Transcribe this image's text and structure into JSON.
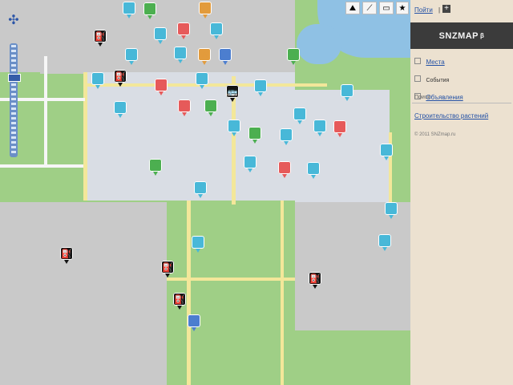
{
  "header": {
    "login": "Пойти",
    "login_sep": "|",
    "logo": "SNZMAP",
    "logo_sup": "β"
  },
  "sidebar": {
    "items": [
      {
        "label": "Места",
        "link": true
      },
      {
        "label": "События",
        "link": false
      },
      {
        "label": "Объявления",
        "link": true
      }
    ],
    "search_label": "Поиск",
    "extra_link": "Строительство растений",
    "footer": "© 2011 SNZmap.ru"
  },
  "colors": {
    "map_green": "#9fcf86",
    "town_gray": "#d9dde4",
    "road_yellow": "#f3e79a",
    "water_blue": "#8fc1e4",
    "panel_bg": "#ece1d0",
    "header_dark": "#3b3b3b",
    "cyan_marker": "#48b8d8",
    "green_marker": "#4caf50",
    "red_marker": "#e65a5a",
    "orange_marker": "#e29b3c",
    "blue_marker": "#4c7ecf",
    "black_marker": "#141414"
  },
  "markers": [
    {
      "name": "marker-cyan-1",
      "icon": "map-pin-icon",
      "color": "#48b8d8"
    },
    {
      "name": "marker-green-1",
      "icon": "map-pin-icon",
      "color": "#4caf50"
    },
    {
      "name": "marker-orange-1",
      "icon": "map-pin-icon",
      "color": "#e29b3c"
    },
    {
      "name": "marker-red-1",
      "icon": "map-pin-icon",
      "color": "#e65a5a"
    },
    {
      "name": "marker-black-1",
      "icon": "fuel-icon",
      "color": "#141414"
    }
  ]
}
